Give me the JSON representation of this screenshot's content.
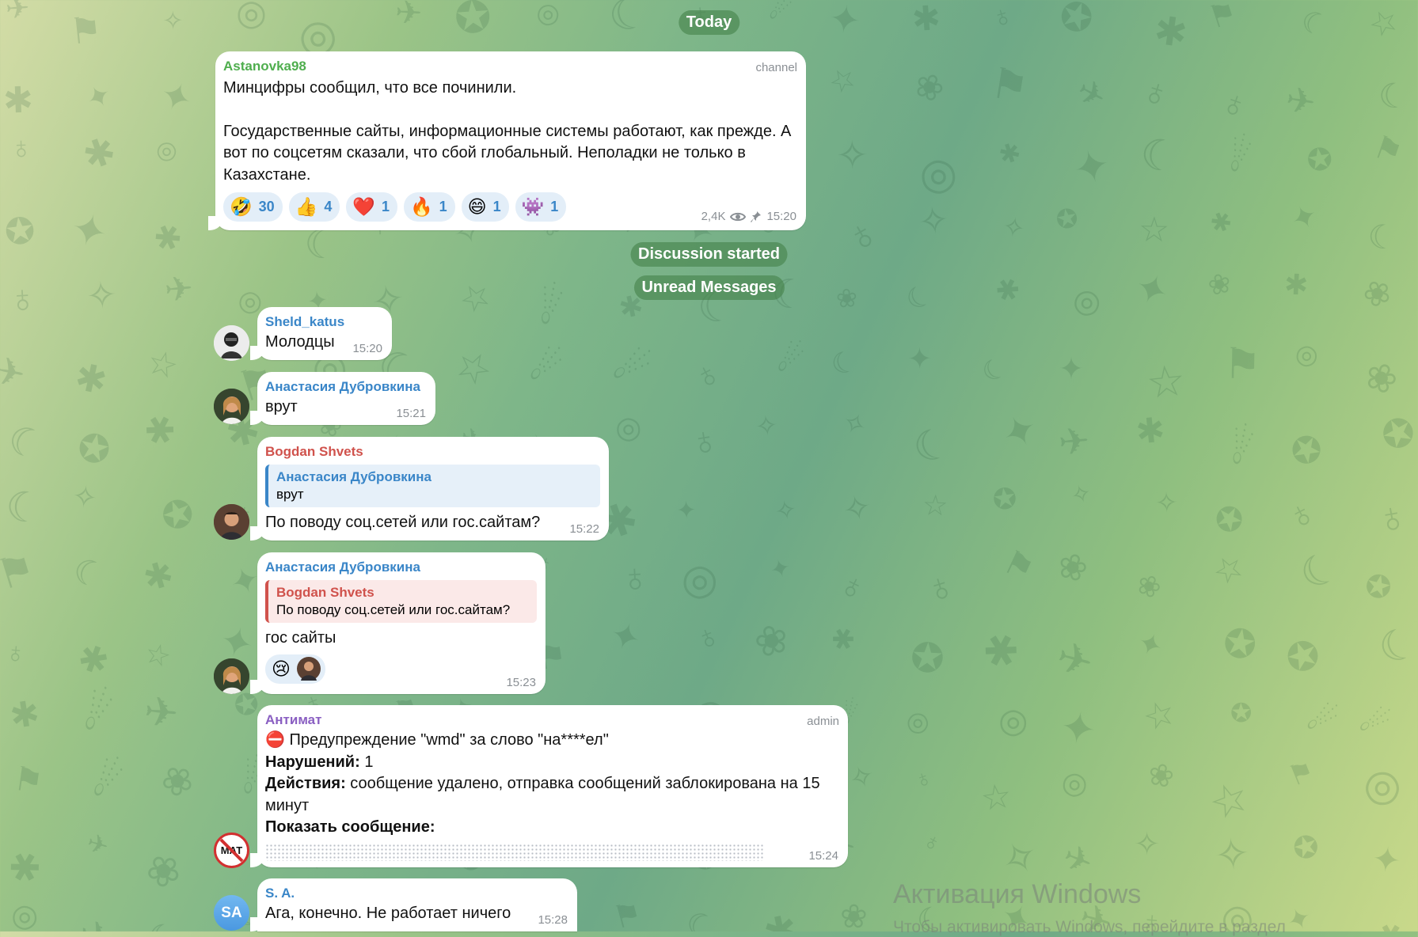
{
  "date_pill": "Today",
  "post": {
    "sender": "Astanovka98",
    "tag": "channel",
    "line1": "Минцифры сообщил, что все починили.",
    "line2": "Государственные сайты, информационные системы работают, как прежде. А вот по соцсетям сказали, что сбой глобальный. Неполадки не только в Казахстане.",
    "reactions": [
      {
        "emoji": "🤣",
        "count": "30"
      },
      {
        "emoji": "👍",
        "count": "4"
      },
      {
        "emoji": "❤️",
        "count": "1"
      },
      {
        "emoji": "🔥",
        "count": "1"
      },
      {
        "emoji": "😄",
        "count": "1"
      },
      {
        "emoji": "👾",
        "count": "1"
      }
    ],
    "views": "2,4K",
    "time": "15:20"
  },
  "discussion_pill": "Discussion started",
  "unread_pill": "Unread Messages",
  "messages": [
    {
      "sender": "Sheld_katus",
      "text": "Молодцы",
      "time": "15:20"
    },
    {
      "sender": "Анастасия Дубровкина",
      "text": "врут",
      "time": "15:21"
    },
    {
      "sender": "Bogdan Shvets",
      "reply_name": "Анастасия Дубровкина",
      "reply_text": "врут",
      "text": "По поводу соц.сетей или гос.сайтам?",
      "time": "15:22"
    },
    {
      "sender": "Анастасия Дубровкина",
      "reply_name": "Bogdan Shvets",
      "reply_text": "По поводу соц.сетей или гос.сайтам?",
      "text": "гос сайты",
      "reaction_emoji": "😢",
      "time": "15:23"
    },
    {
      "sender": "Антимат",
      "tag": "admin",
      "warning": "⛔ Предупреждение \"wmd\" за слово \"на****ел\"",
      "violations_label": "Нарушений:",
      "violations_value": " 1",
      "actions_label": "Действия:",
      "actions_value": " сообщение удалено, отправка сообщений заблокирована на 15 минут",
      "show_label": "Показать сообщение:",
      "time": "15:24",
      "avatar_text": "МАТ"
    },
    {
      "sender": "S. A.",
      "text": "Ага, конечно. Не работает ничего",
      "time": "15:28",
      "avatar_text": "SA"
    }
  ],
  "watermark": {
    "title": "Активация Windows",
    "subtitle": "Чтобы активировать Windows, перейдите в раздел"
  },
  "colors": {
    "green_name": "#4fae4e",
    "blue_name": "#3a86c8",
    "red_name": "#d0524c",
    "purple_name": "#8a5fc2",
    "reply_blue_bg": "#e6f0f9",
    "reply_red_bg": "#fbe9e8"
  }
}
